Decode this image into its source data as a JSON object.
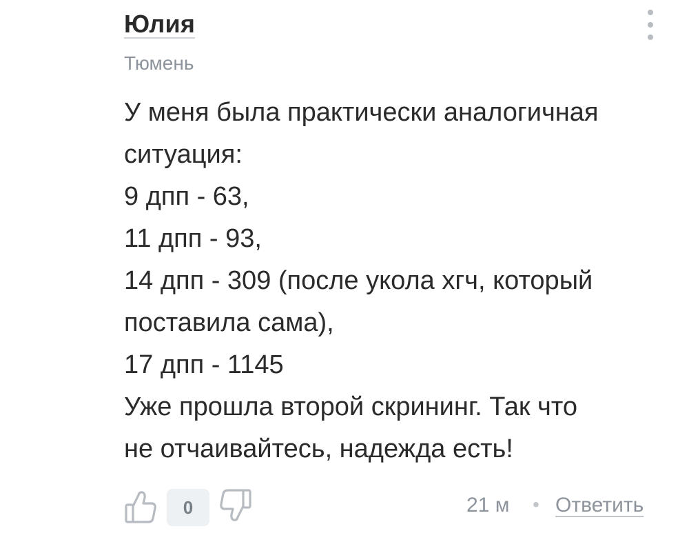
{
  "comment": {
    "author": "Юлия",
    "city": "Тюмень",
    "lines": [
      "У меня была практически аналогичная",
      "ситуация:",
      "9 дпп - 63,",
      "11 дпп - 93,",
      "14 дпп - 309 (после укола хгч, который",
      "поставила сама),",
      "17 дпп - 1145",
      "Уже прошла второй скрининг. Так что",
      "не отчаивайтесь, надежда есть!"
    ],
    "rating": "0",
    "time": "21 м",
    "separator": "•",
    "reply_label": "Ответить"
  },
  "icons": {
    "menu": "more-vertical-icon",
    "like": "thumbs-up-icon",
    "dislike": "thumbs-down-icon"
  },
  "colors": {
    "text": "#2b2b2b",
    "meta": "#8d949c",
    "icon": "#b7bcc2",
    "badge_bg": "#eef1f3"
  }
}
